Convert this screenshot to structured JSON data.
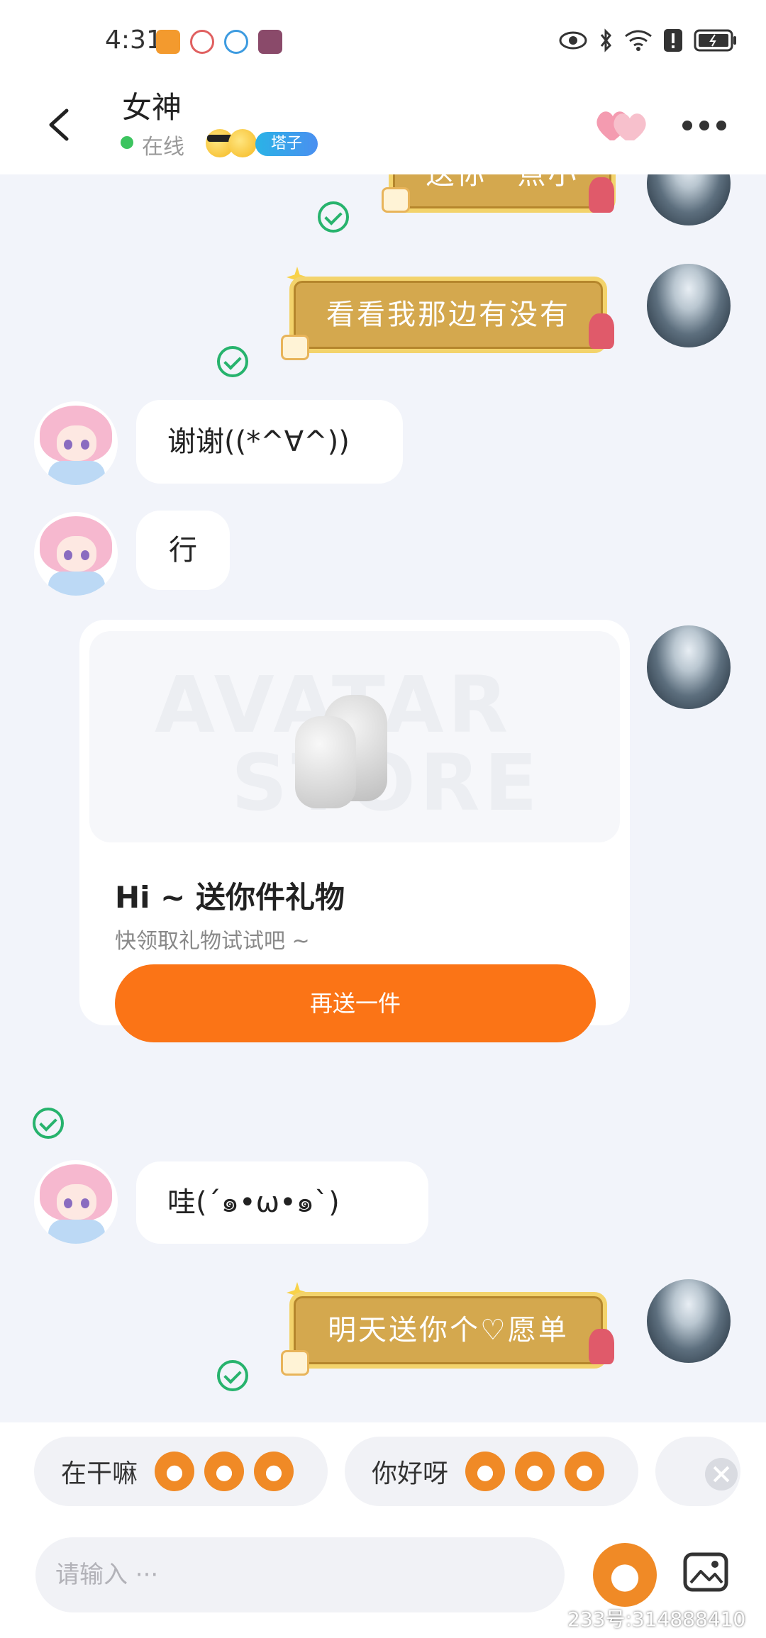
{
  "status_bar": {
    "time": "4:31"
  },
  "header": {
    "title": "女神",
    "status": "在线",
    "tag": "塔子"
  },
  "messages": [
    {
      "from": "me",
      "text": "送你一点小",
      "style": "gold"
    },
    {
      "from": "me",
      "text": "看看我那边有没有",
      "style": "gold"
    },
    {
      "from": "other",
      "text": "谢谢((*^∀^))",
      "style": "white"
    },
    {
      "from": "other",
      "text": "行",
      "style": "white"
    },
    {
      "from": "me",
      "style": "gift_card"
    },
    {
      "from": "other",
      "text": "哇(´๑•ω•๑`)",
      "style": "white"
    },
    {
      "from": "me",
      "text": "明天送你个♡愿单",
      "style": "gold"
    }
  ],
  "gift_card": {
    "watermark_1": "AVATAR",
    "watermark_2": "STORE",
    "title": "Hi ~ 送你件礼物",
    "subtitle": "快领取礼物试试吧 ~",
    "button": "再送一件"
  },
  "quick_replies": [
    {
      "label": "在干嘛",
      "emoji": "mascot-grin-icon"
    },
    {
      "label": "你好呀",
      "emoji": "mascot-surprised-icon"
    }
  ],
  "input": {
    "placeholder": "请输入 ···"
  },
  "watermark": "233号:314888410",
  "colors": {
    "accent": "#fb7416",
    "online": "#3cc45f",
    "read_check": "#27b36d",
    "gold_bubble": "#d4a84e"
  }
}
